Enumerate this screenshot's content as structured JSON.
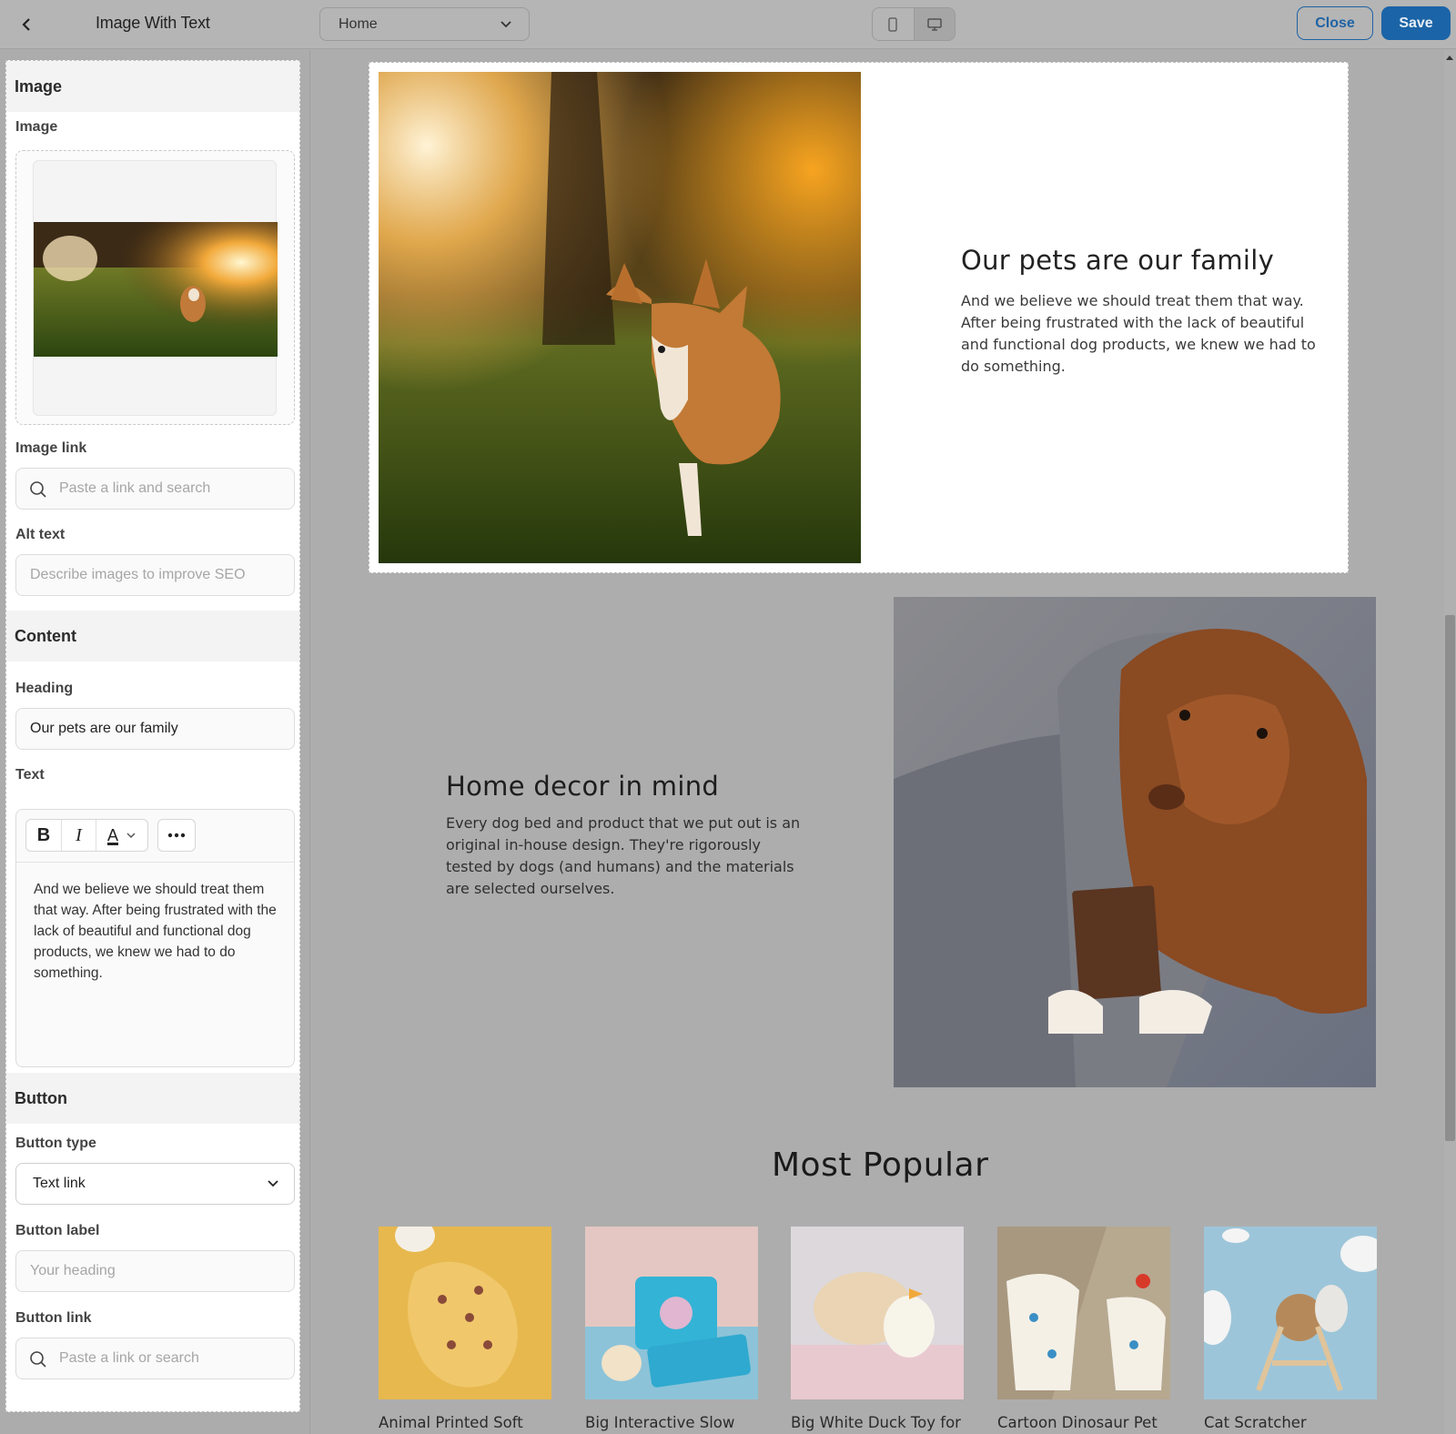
{
  "topbar": {
    "title": "Image With Text",
    "page_select": "Home",
    "close_label": "Close",
    "save_label": "Save"
  },
  "sidebar": {
    "image_section": {
      "heading": "Image",
      "image_label": "Image",
      "image_link_label": "Image link",
      "image_link_placeholder": "Paste a link and search",
      "alt_text_label": "Alt text",
      "alt_text_placeholder": "Describe images to improve SEO"
    },
    "content_section": {
      "heading": "Content",
      "heading_label": "Heading",
      "heading_value": "Our pets are our family",
      "text_label": "Text",
      "text_value": "And we believe we should treat them that way. After being frustrated with the lack of beautiful and functional dog products, we knew we had to do something.",
      "toolbar": {
        "bold": "B",
        "italic": "I",
        "color": "A"
      }
    },
    "button_section": {
      "heading": "Button",
      "button_type_label": "Button type",
      "button_type_value": "Text link",
      "button_label_label": "Button label",
      "button_label_placeholder": "Your heading",
      "button_link_label": "Button link",
      "button_link_placeholder": "Paste a link or search"
    }
  },
  "canvas": {
    "section1": {
      "heading": "Our pets are our family",
      "text": "And we believe we should treat them that way. After being frustrated with the lack of beautiful and functional dog products, we knew we had to do something."
    },
    "section2": {
      "heading": "Home decor in mind",
      "text": "Every dog bed and product that we put out is an original in-house design. They're rigorously tested by dogs (and humans) and the materials are selected ourselves."
    },
    "most_popular": {
      "title": "Most Popular",
      "products": [
        {
          "name": "Animal Printed Soft"
        },
        {
          "name": "Big Interactive Slow"
        },
        {
          "name": "Big White Duck Toy for"
        },
        {
          "name": "Cartoon Dinosaur Pet"
        },
        {
          "name": "Cat Scratcher"
        }
      ]
    }
  },
  "icons": {
    "back": "chevron-left-icon",
    "page_select": "chevron-down-icon",
    "mobile": "mobile-icon",
    "desktop": "desktop-icon",
    "search": "search-icon",
    "more": "more-horizontal-icon"
  },
  "colors": {
    "accent": "#1b64a7",
    "overlay": "#adadad"
  }
}
